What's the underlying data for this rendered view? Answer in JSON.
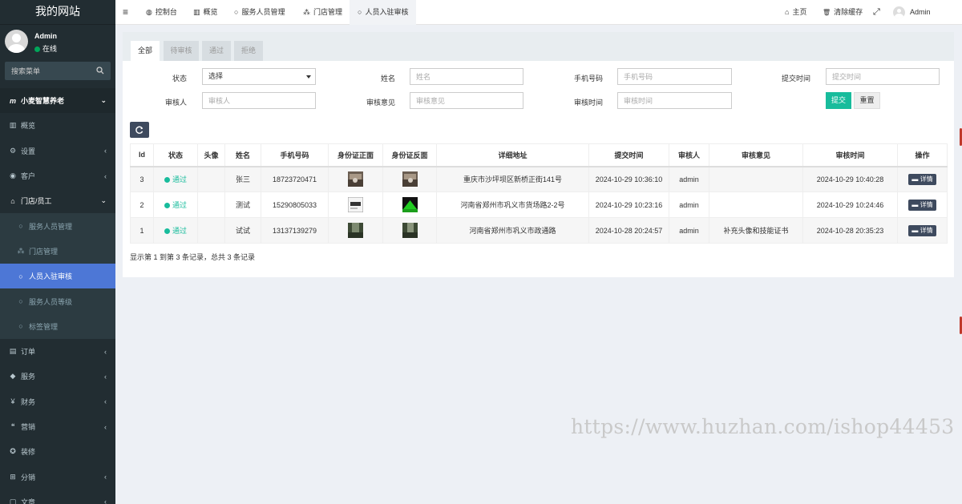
{
  "sidebar": {
    "logo": "我的网站",
    "user_name": "Admin",
    "user_status": "在线",
    "search_placeholder": "搜索菜单",
    "items": [
      {
        "icon": "m",
        "label": "小麦智慧养老",
        "type": "top",
        "arrow": "⌄"
      },
      {
        "icon": "▥",
        "label": "概览",
        "type": "normal",
        "arrow": ""
      },
      {
        "icon": "⚙",
        "label": "设置",
        "type": "normal",
        "arrow": "‹"
      },
      {
        "icon": "◉",
        "label": "客户",
        "type": "normal",
        "arrow": "‹"
      },
      {
        "icon": "⌂",
        "label": "门店/员工",
        "type": "section",
        "arrow": "⌄"
      },
      {
        "icon": "○",
        "label": "服务人员管理",
        "type": "sub",
        "arrow": ""
      },
      {
        "icon": "⁂",
        "label": "门店管理",
        "type": "sub",
        "arrow": ""
      },
      {
        "icon": "○",
        "label": "人员入驻审核",
        "type": "sub-active",
        "arrow": ""
      },
      {
        "icon": "○",
        "label": "服务人员等级",
        "type": "sub",
        "arrow": ""
      },
      {
        "icon": "○",
        "label": "标签管理",
        "type": "sub",
        "arrow": ""
      },
      {
        "icon": "▤",
        "label": "订单",
        "type": "normal",
        "arrow": "‹"
      },
      {
        "icon": "◆",
        "label": "服务",
        "type": "normal",
        "arrow": "‹"
      },
      {
        "icon": "¥",
        "label": "财务",
        "type": "normal",
        "arrow": "‹"
      },
      {
        "icon": "❝",
        "label": "营销",
        "type": "normal",
        "arrow": "‹"
      },
      {
        "icon": "✪",
        "label": "装修",
        "type": "normal",
        "arrow": ""
      },
      {
        "icon": "⊞",
        "label": "分销",
        "type": "normal",
        "arrow": "‹"
      },
      {
        "icon": "▢",
        "label": "文章",
        "type": "normal",
        "arrow": "‹"
      }
    ]
  },
  "navbar": {
    "menu_icon": "≡",
    "tabs": [
      {
        "icon": "◍",
        "label": "控制台"
      },
      {
        "icon": "▥",
        "label": "概览"
      },
      {
        "icon": "○",
        "label": "服务人员管理"
      },
      {
        "icon": "⁂",
        "label": "门店管理"
      },
      {
        "icon": "○",
        "label": "人员入驻审核"
      }
    ],
    "home": "主页",
    "home_icon": "⌂",
    "clear_cache": "清除缓存",
    "clear_icon": "🗑",
    "fullscreen_icon": "⤢",
    "admin": "Admin"
  },
  "filter_tabs": [
    "全部",
    "待审核",
    "通过",
    "拒绝"
  ],
  "form": {
    "status_label": "状态",
    "status_value": "选择",
    "name_label": "姓名",
    "name_placeholder": "姓名",
    "phone_label": "手机号码",
    "phone_placeholder": "手机号码",
    "submit_time_label": "提交时间",
    "submit_time_placeholder": "提交时间",
    "reviewer_label": "审核人",
    "reviewer_placeholder": "审核人",
    "opinion_label": "审核意见",
    "opinion_placeholder": "审核意见",
    "review_time_label": "审核时间",
    "review_time_placeholder": "审核时间",
    "submit_btn": "提交",
    "reset_btn": "重置"
  },
  "table": {
    "headers": [
      "Id",
      "状态",
      "头像",
      "姓名",
      "手机号码",
      "身份证正面",
      "身份证反面",
      "详细地址",
      "提交时间",
      "审核人",
      "审核意见",
      "审核时间",
      "操作"
    ],
    "rows": [
      {
        "id": "3",
        "status": "通过",
        "avatar": "",
        "name": "张三",
        "phone": "18723720471",
        "address": "重庆市沙坪坝区新桥正街141号",
        "submit_time": "2024-10-29 10:36:10",
        "reviewer": "admin",
        "opinion": "",
        "review_time": "2024-10-29 10:40:28",
        "action": "详情"
      },
      {
        "id": "2",
        "status": "通过",
        "avatar": "",
        "name": "测试",
        "phone": "15290805033",
        "address": "河南省郑州市巩义市货场路2-2号",
        "submit_time": "2024-10-29 10:23:16",
        "reviewer": "admin",
        "opinion": "",
        "review_time": "2024-10-29 10:24:46",
        "action": "详情"
      },
      {
        "id": "1",
        "status": "通过",
        "avatar": "",
        "name": "试试",
        "phone": "13137139279",
        "address": "河南省郑州市巩义市政通路",
        "submit_time": "2024-10-28 20:24:57",
        "reviewer": "admin",
        "opinion": "补充头像和技能证书",
        "review_time": "2024-10-28 20:35:23",
        "action": "详情"
      }
    ]
  },
  "pager_text": "显示第 1 到第 3 条记录，总共 3 条记录",
  "watermark": "https://www.huzhan.com/ishop44453",
  "colors": {
    "sidebar_bg": "#222d32",
    "active_menu": "#4d77d6",
    "accent_green": "#18bc9c",
    "dark_button": "#3e4a5e"
  }
}
